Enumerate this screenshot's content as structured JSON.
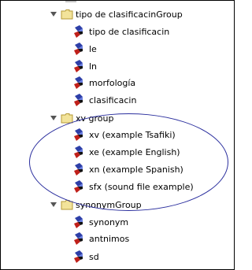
{
  "tree": {
    "groups": [
      {
        "label": "tipo de clasificacinGroup",
        "items": [
          "tipo de clasificacin",
          "le",
          "ln",
          "morfología",
          "clasificacin"
        ]
      },
      {
        "label": "xv group",
        "items": [
          "xv (example Tsafiki)",
          "xe (example English)",
          "xn (example Spanish)",
          "sfx (sound file example)"
        ]
      },
      {
        "label": "synonymGroup",
        "items": [
          "synonym",
          "antnimos",
          "sd"
        ]
      }
    ]
  },
  "colors": {
    "folder": "#f2e39a",
    "folder_edge": "#b59a35",
    "gem_blue": "#2d3fa8",
    "gem_red": "#c0201a",
    "annotation_ellipse": "#2b2f9e"
  },
  "icons": {
    "expander": "expanded-triangle-icon",
    "group": "folder-icon",
    "item": "element-gem-icon"
  }
}
